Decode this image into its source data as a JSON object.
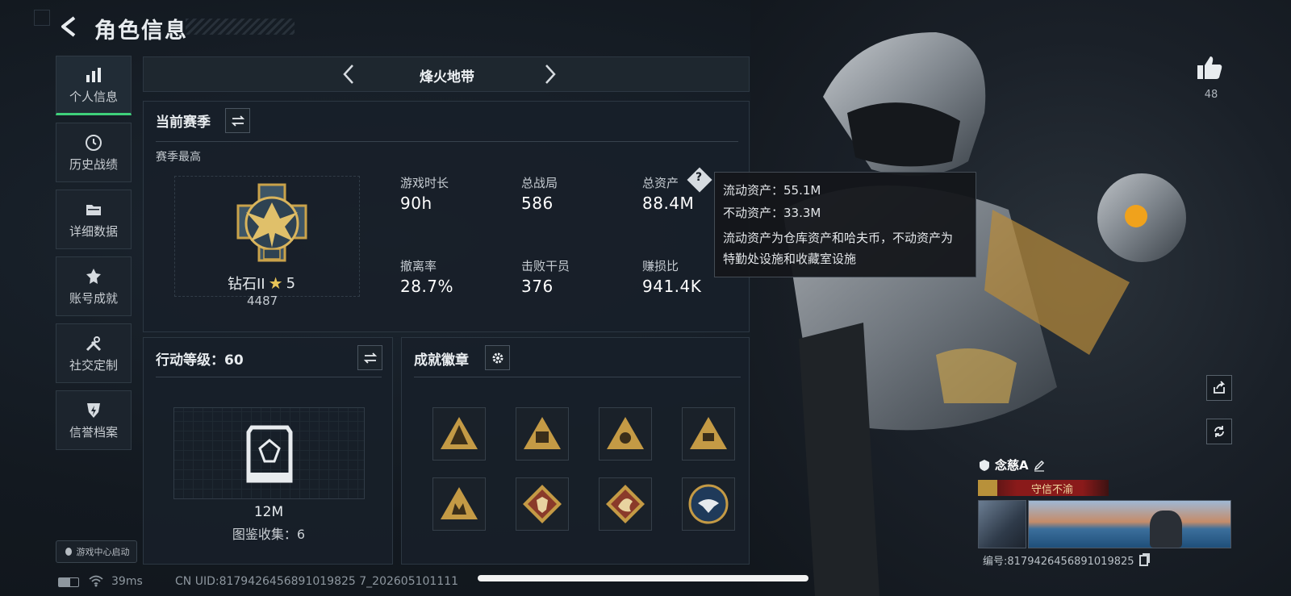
{
  "header": {
    "title": "角色信息"
  },
  "sidebar": {
    "items": [
      {
        "label": "个人信息",
        "icon": "bar-chart-icon"
      },
      {
        "label": "历史战绩",
        "icon": "history-clock-icon"
      },
      {
        "label": "详细数据",
        "icon": "folder-icon"
      },
      {
        "label": "账号成就",
        "icon": "achievement-icon"
      },
      {
        "label": "社交定制",
        "icon": "tools-icon"
      },
      {
        "label": "信誉档案",
        "icon": "credit-badge-icon"
      }
    ],
    "game_center": "游戏中心启动"
  },
  "mode": {
    "label": "烽火地带"
  },
  "season": {
    "title": "当前赛季",
    "best_label": "赛季最高",
    "rank_name": "钻石II",
    "rank_stars": "5",
    "rank_score": "4487",
    "stats": [
      {
        "label": "游戏时长",
        "value": "90h"
      },
      {
        "label": "总战局",
        "value": "586"
      },
      {
        "label": "总资产",
        "value": "88.4M"
      },
      {
        "label": "撤离率",
        "value": "28.7%"
      },
      {
        "label": "击败干员",
        "value": "376"
      },
      {
        "label": "赚损比",
        "value": "941.4K"
      }
    ]
  },
  "tooltip": {
    "liquid": "流动资产：55.1M",
    "fixed": "不动资产：33.3M",
    "note_line1": "流动资产为仓库资产和哈夫币，不动资产为",
    "note_line2": "特勤处设施和收藏室设施"
  },
  "action_level": {
    "title": "行动等级：60",
    "value": "12M",
    "collection": "图鉴收集：6"
  },
  "badges": {
    "title": "成就徽章",
    "items": [
      {
        "icon": "triangle-badge-icon"
      },
      {
        "icon": "triangle-badge-icon"
      },
      {
        "icon": "triangle-badge-icon"
      },
      {
        "icon": "triangle-badge-icon"
      },
      {
        "icon": "triangle-badge-icon"
      },
      {
        "icon": "diamond-wolf-badge-icon"
      },
      {
        "icon": "diamond-dragon-badge-icon"
      },
      {
        "icon": "eagle-circle-badge-icon"
      }
    ]
  },
  "likes": {
    "count": "48"
  },
  "player": {
    "name": "念慈A",
    "title": "守信不渝",
    "id": "编号:8179426456891019825"
  },
  "status": {
    "ping": "39ms",
    "uid": "CN UID:8179426456891019825 7_202605101111"
  },
  "colors": {
    "accent": "#3fd07a",
    "gold": "#c9a24a",
    "title_red": "#8a1a1a"
  }
}
